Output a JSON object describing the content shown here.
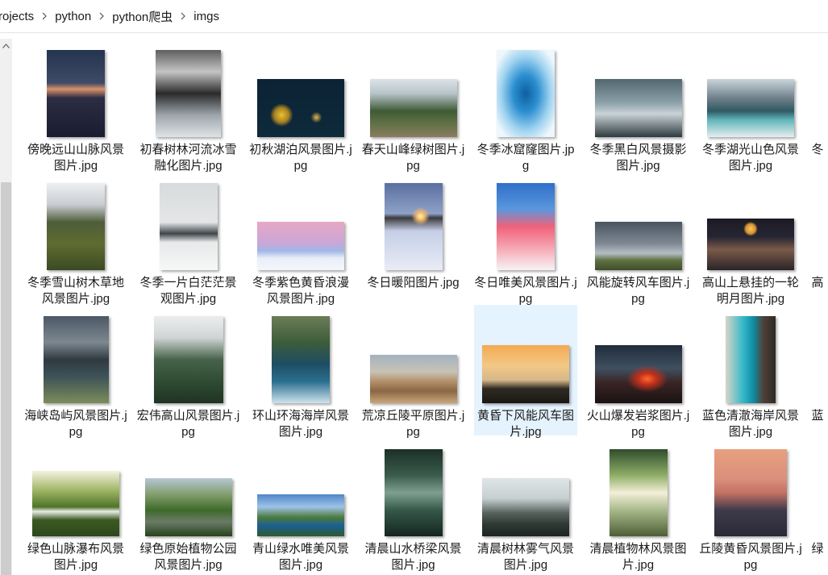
{
  "breadcrumb": [
    "rojects",
    "python",
    "python爬虫",
    "imgs"
  ],
  "files": [
    {
      "label": "傍晚远山山脉风景图片.jpg",
      "w": 72,
      "h": 108,
      "g": "linear-gradient(to bottom,#24344f 0%,#3f4a66 38%,#d9926a 45%,#2c2d44 55%,#1a1c30 100%)"
    },
    {
      "label": "初春树林河流冰雪融化图片.jpg",
      "w": 81,
      "h": 108,
      "g": "linear-gradient(to bottom,#5f5f5f 0%,#c4c4c4 25%,#2a2a2a 50%,#9ea6ad 75%,#dfe3e6 100%)"
    },
    {
      "label": "初秋湖泊风景图片.jpg",
      "w": 108,
      "h": 72,
      "g": "radial-gradient(circle at 28% 62%,#e8c233 0%,#a88122 10%,rgba(0,0,0,0) 16%),radial-gradient(circle at 68% 66%,#e9b44a 0%,rgba(0,0,0,0) 8%),linear-gradient(to bottom,#0b2334 0%,#0e2a3b 100%)"
    },
    {
      "label": "春天山峰绿树图片.jpg",
      "w": 108,
      "h": 72,
      "g": "linear-gradient(to bottom,#dce3e8 0%,#b7c4c9 25%,#3f5a35 55%,#5e7044 75%,#8c7c5f 100%)"
    },
    {
      "label": "冬季冰窟窿图片.jpg",
      "w": 72,
      "h": 108,
      "g": "radial-gradient(ellipse at 50% 50%,#0d5fa0 0%,#2c8fd0 30%,#9fd3f0 60%,#eef7fb 85%)"
    },
    {
      "label": "冬季黑白风景摄影图片.jpg",
      "w": 108,
      "h": 72,
      "g": "linear-gradient(to bottom,#51666e 0%,#8aa0a8 40%,#c9d3d6 60%,#2d3a3f 100%)"
    },
    {
      "label": "冬季湖光山色风景图片.jpg",
      "w": 108,
      "h": 72,
      "g": "linear-gradient(to bottom,#c9d5db 0%,#6a7b86 35%,#2f5963 55%,#5fb4b8 70%,#e6eef0 100%)"
    },
    {
      "label": "冬季雪山树木草地风景图片.jpg",
      "w": 72,
      "h": 108,
      "g": "linear-gradient(to bottom,#eef0f2 0%,#c8ccd0 25%,#4e5d3a 45%,#5f6b30 70%,#3b4a24 100%)"
    },
    {
      "label": "冬季一片白茫茫景观图片.jpg",
      "w": 72,
      "h": 108,
      "g": "linear-gradient(to bottom,#d8dbdd 0%,#e4e6e7 45%,#404549 58%,#e7e9ea 68%,#f6f7f7 100%)"
    },
    {
      "label": "冬季紫色黄昏浪漫风景图片.jpg",
      "w": 108,
      "h": 60,
      "g": "linear-gradient(to bottom,#e7a7c4 0%,#c9a7d8 45%,#9fb7e6 60%,#e9eef8 75%,#f4f6fb 100%)"
    },
    {
      "label": "冬日暖阳图片.jpg",
      "w": 72,
      "h": 108,
      "g": "radial-gradient(circle at 62% 38%,#fff3b0 0%,#f0b86b 6%,rgba(0,0,0,0) 14%),linear-gradient(to bottom,#5a6fa0 0%,#8fa1c7 35%,#3b3a3e 40%,#c5cee6 55%,#e8ecf6 100%)"
    },
    {
      "label": "冬日唯美风景图片.jpg",
      "w": 72,
      "h": 108,
      "g": "linear-gradient(to bottom,#2f6fc8 0%,#5a97de 30%,#f0617a 50%,#f59aa8 70%,#f7f3f6 100%)"
    },
    {
      "label": "风能旋转风车图片.jpg",
      "w": 108,
      "h": 60,
      "g": "linear-gradient(to bottom,#4a5461 0%,#7e8892 45%,#b5bdc4 65%,#5e7040 80%,#3f4d2b 100%)"
    },
    {
      "label": "高山上悬挂的一轮明月图片.jpg",
      "w": 108,
      "h": 64,
      "g": "radial-gradient(circle at 50% 20%,#f6c56a 0%,#d9932d 8%,rgba(0,0,0,0) 12%),linear-gradient(to bottom,#1c1b24 0%,#252533 35%,#7a5a48 60%,#2a2429 100%)"
    },
    {
      "label": "海峡岛屿风景图片.jpg",
      "w": 81,
      "h": 108,
      "g": "linear-gradient(to bottom,#4b5866 0%,#7d8890 30%,#2f3a40 50%,#3f5358 70%,#7b8d5a 100%)"
    },
    {
      "label": "宏伟高山风景图片.jpg",
      "w": 86,
      "h": 108,
      "g": "linear-gradient(to bottom,#eceeee 0%,#cfd4d4 25%,#47624a 50%,#2f4c33 75%,#1f3322 100%)"
    },
    {
      "label": "环山环海海岸风景图片.jpg",
      "w": 72,
      "h": 108,
      "g": "linear-gradient(to bottom,#6b7c58 0%,#3d5d3a 30%,#1e4d64 55%,#2a6f8f 75%,#cfe3ec 100%)"
    },
    {
      "label": "荒凉丘陵平原图片.jpg",
      "w": 108,
      "h": 60,
      "g": "linear-gradient(to bottom,#a2b2bf 0%,#c8c3b6 35%,#b39068 55%,#8a6744 75%,#caa67a 100%)"
    },
    {
      "label": "黄昏下风能风车图片.jpg",
      "w": 108,
      "h": 72,
      "g": "linear-gradient(to bottom,#f4a951 0%,#f2c886 35%,#d7b889 60%,#2f2a22 75%,#1a1714 100%)"
    },
    {
      "label": "火山爆发岩浆图片.jpg",
      "w": 108,
      "h": 72,
      "g": "radial-gradient(ellipse at 60% 58%,#ff6a2a 0%,#c2301b 12%,rgba(0,0,0,0) 28%),linear-gradient(to bottom,#202c3a 0%,#3f5060 40%,#3a2424 65%,#1a1212 100%)"
    },
    {
      "label": "蓝色清澈海岸风景图片.jpg",
      "w": 62,
      "h": 108,
      "g": "linear-gradient(to right,#d9d4c7 0%,#35b8c8 35%,#0f8ea8 55%,#4e4138 75%,#2f2924 100%)"
    },
    {
      "label": "绿色山脉瀑布风景图片.jpg",
      "w": 108,
      "h": 81,
      "g": "linear-gradient(to bottom,#f4f1df 0%,#9fb564 30%,#4f7328 55%,#e8ece6 62%,#3c5a23 75%,#2d471b 100%)"
    },
    {
      "label": "绿色原始植物公园风景图片.jpg",
      "w": 108,
      "h": 72,
      "g": "linear-gradient(to bottom,#b7c7d5 0%,#7e9a66 30%,#3e6a2b 55%,#6b7b66 75%,#27421c 100%)"
    },
    {
      "label": "青山绿水唯美风景图片.jpg",
      "w": 108,
      "h": 52,
      "g": "linear-gradient(to bottom,#4f86c8 0%,#9ec3e8 30%,#4c7a3b 55%,#1b5f93 75%,#2f5a2c 100%)"
    },
    {
      "label": "清晨山水桥梁风景图片.jpg",
      "w": 72,
      "h": 108,
      "g": "linear-gradient(to bottom,#1b2f27 0%,#3b5b4d 30%,#7fa090 50%,#35584a 70%,#14261f 100%)"
    },
    {
      "label": "清晨树林雾气风景图片.jpg",
      "w": 108,
      "h": 72,
      "g": "linear-gradient(to bottom,#dfe5e6 0%,#c6cfd0 35%,#57625c 60%,#2d3834 80%,#1d2421 100%)"
    },
    {
      "label": "清晨植物林风景图片.jpg",
      "w": 72,
      "h": 108,
      "g": "linear-gradient(to bottom,#2f4d2c 0%,#8fae67 30%,#f4efd8 50%,#a7b98a 70%,#4d5e36 100%)"
    },
    {
      "label": "丘陵黄昏风景图片.jpg",
      "w": 90,
      "h": 108,
      "g": "linear-gradient(to bottom,#e8a07d 0%,#d98f7d 35%,#c47162 50%,#3e3a4c 70%,#2a2a36 100%)"
    }
  ],
  "partial_labels": [
    "冬",
    "高",
    "蓝",
    "绿"
  ],
  "selected_index": 18
}
